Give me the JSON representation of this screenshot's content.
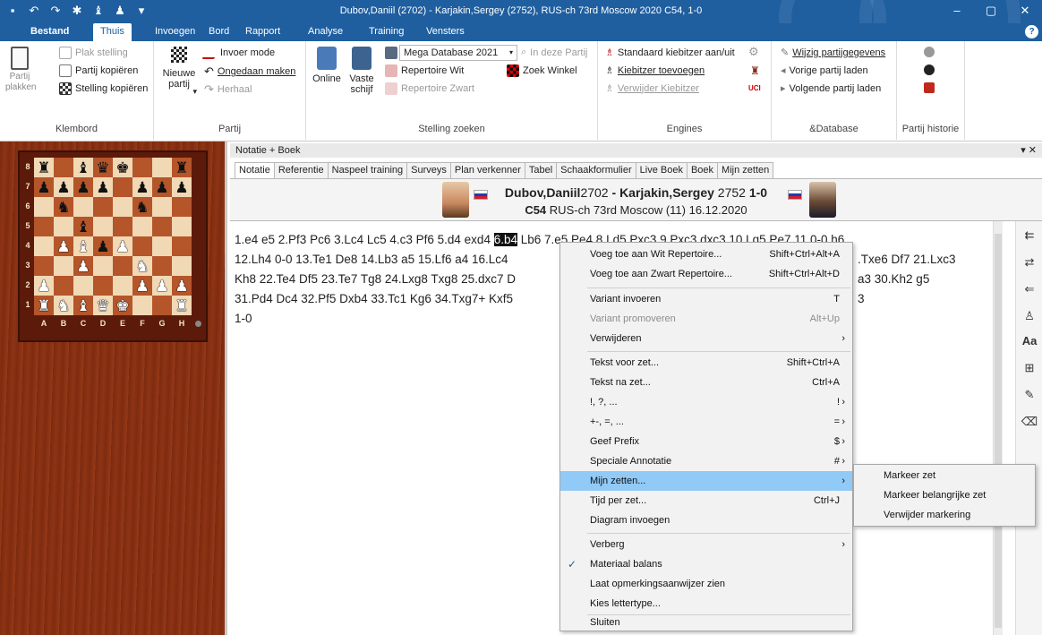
{
  "window": {
    "title": "Dubov,Daniil (2702) - Karjakin,Sergey (2752), RUS-ch 73rd Moscow 2020  C54, 1-0",
    "qa_icons": [
      "save-icon",
      "undo-icon",
      "redo-icon",
      "engine-icon",
      "pieces-icon",
      "pin-icon",
      "dropdown-icon"
    ],
    "controls": {
      "minimize": "–",
      "maximize": "▢",
      "close": "✕"
    }
  },
  "ribbon_tabs": [
    "Bestand",
    "Thuis",
    "Invoegen",
    "Bord",
    "Rapport",
    "Analyse",
    "Training",
    "Vensters"
  ],
  "active_tab": "Thuis",
  "ribbon": {
    "klembord": {
      "paste": "Partij plakken",
      "items": [
        "Plak stelling",
        "Partij kopiëren",
        "Stelling kopiëren"
      ],
      "label": "Klembord"
    },
    "partij": {
      "new_game": "Nieuwe partij",
      "new_game_caret": "▾",
      "items": [
        "Invoer mode",
        "Ongedaan maken",
        "Herhaal"
      ],
      "label": "Partij"
    },
    "stelling": {
      "online": "Online",
      "vaste_schijf": "Vaste schijf",
      "database": "Mega Database 2021",
      "in_deze_partij": "In deze Partij",
      "repertoire_wit": "Repertoire Wit",
      "zoek_winkel": "Zoek Winkel",
      "repertoire_zwart": "Repertoire Zwart",
      "label": "Stelling zoeken"
    },
    "engines": {
      "items": [
        "Standaard kiebitzer aan/uit",
        "Kiebitzer toevoegen",
        "Verwijder Kiebitzer"
      ],
      "label": "Engines"
    },
    "database": {
      "items": [
        "Wijzig partijgegevens",
        "Vorige partij laden",
        "Volgende partij laden"
      ],
      "label": "&Database"
    },
    "historie": {
      "label": "Partij historie"
    }
  },
  "board": {
    "ranks": [
      "8",
      "7",
      "6",
      "5",
      "4",
      "3",
      "2",
      "1"
    ],
    "files": [
      "A",
      "B",
      "C",
      "D",
      "E",
      "F",
      "G",
      "H"
    ],
    "position": [
      "r.bqk..r",
      "pppp.ppp",
      ".n...n..",
      "..b.....",
      ".PBpP...",
      "..P..N..",
      "P....PPP",
      "RNBQK..R"
    ]
  },
  "notebook": {
    "title": "Notatie + Boek",
    "pin_label": "▾",
    "close_label": "✕",
    "tabs": [
      "Notatie",
      "Referentie",
      "Naspeel training",
      "Surveys",
      "Plan verkenner",
      "Tabel",
      "Schaakformulier",
      "Live Boek",
      "Boek",
      "Mijn zetten"
    ],
    "active_tab": "Notatie"
  },
  "game": {
    "white": "Dubov,Daniil",
    "white_elo": "2702",
    "sep": " - ",
    "black": "Karjakin,Sergey",
    "black_elo": "2752",
    "result": "1-0",
    "eco": "C54",
    "event": "RUS-ch 73rd Moscow (11) 16.12.2020"
  },
  "notation": {
    "l1a": "1.e4 e5 2.Pf3 Pc6 3.Lc4 Lc5 4.c3 Pf6 5.d4 exd4 ",
    "l1sel": "6.b4",
    "l1b": " Lb6 7.e5 Pe4 8.Ld5 Pxc3 9.Pxc3 dxc3 10.Lg5 Pe7 11.0-0 h6",
    "l2a": "12.Lh4 0-0 13.Te1 De8 14.Lb3 a5 15.Lf6 a4 16.Lc4",
    "l2b": ".Txe6 Df7 21.Lxc3",
    "l3a": "Kh8 22.Te4 Df5 23.Te7 Tg8 24.Lxg8 Txg8 25.dxc7 D",
    "l3b": "a3 30.Kh2 g5",
    "l4a": "31.Pd4 Dc4 32.Pf5 Dxb4 33.Tc1 Kg6 34.Txg7+ Kxf5",
    "l4b": "3",
    "l5": "1-0"
  },
  "context_menu": {
    "voeg_wit": {
      "label": "Voeg toe aan Wit Repertoire...",
      "shortcut": "Shift+Ctrl+Alt+A"
    },
    "voeg_zwart": {
      "label": "Voeg toe aan Zwart Repertoire...",
      "shortcut": "Shift+Ctrl+Alt+D"
    },
    "variant_invoeren": {
      "label": "Variant invoeren",
      "shortcut": "T"
    },
    "variant_promoveren": {
      "label": "Variant promoveren",
      "shortcut": "Alt+Up"
    },
    "verwijderen": {
      "label": "Verwijderen"
    },
    "tekst_voor": {
      "label": "Tekst voor zet...",
      "shortcut": "Shift+Ctrl+A"
    },
    "tekst_na": {
      "label": "Tekst na zet...",
      "shortcut": "Ctrl+A"
    },
    "annot1": {
      "label": "!, ?, ...",
      "shortcut": "!"
    },
    "annot2": {
      "label": "+-, =, ...",
      "shortcut": "="
    },
    "geef_prefix": {
      "label": "Geef Prefix",
      "shortcut": "$"
    },
    "speciale": {
      "label": "Speciale Annotatie",
      "shortcut": "#"
    },
    "mijn_zetten": {
      "label": "Mijn zetten..."
    },
    "tijd": {
      "label": "Tijd per zet...",
      "shortcut": "Ctrl+J"
    },
    "diagram": {
      "label": "Diagram invoegen"
    },
    "verberg": {
      "label": "Verberg"
    },
    "materiaal": {
      "label": "Materiaal balans",
      "checked": "✓"
    },
    "opmerking": {
      "label": "Laat opmerkingsaanwijzer zien"
    },
    "lettertype": {
      "label": "Kies lettertype..."
    },
    "sluiten": {
      "label": "Sluiten"
    },
    "arrow": "›"
  },
  "submenu": {
    "items": [
      "Markeer zet",
      "Markeer belangrijke zet",
      "Verwijder markering"
    ]
  },
  "colors": {
    "title_blue": "#1f5fa0",
    "highlight": "#91c9f7",
    "board_dark": "#b5552a",
    "board_light": "#f1d9b5"
  }
}
